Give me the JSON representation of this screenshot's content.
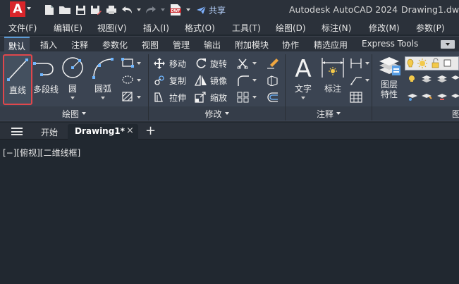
{
  "title_bar": {
    "app_letter": "A",
    "share_label": "共享",
    "dwf_label": "DWF",
    "app_title": "Autodesk AutoCAD 2024",
    "file_title": "Drawing1.dwg"
  },
  "menu": {
    "items": [
      "文件(F)",
      "编辑(E)",
      "视图(V)",
      "插入(I)",
      "格式(O)",
      "工具(T)",
      "绘图(D)",
      "标注(N)",
      "修改(M)",
      "参数(P)"
    ]
  },
  "ribbon_tabs": {
    "items": [
      "默认",
      "插入",
      "注释",
      "参数化",
      "视图",
      "管理",
      "输出",
      "附加模块",
      "协作",
      "精选应用",
      "Express Tools"
    ]
  },
  "draw_panel": {
    "title": "绘图",
    "line": "直线",
    "polyline": "多段线",
    "circle": "圆",
    "arc": "圆弧"
  },
  "modify_panel": {
    "title": "修改",
    "move": "移动",
    "rotate": "旋转",
    "copy": "复制",
    "mirror": "镜像",
    "stretch": "拉伸",
    "scale": "缩放"
  },
  "annotation_panel": {
    "title": "注释",
    "text": "文字",
    "dimension": "标注"
  },
  "layers_panel": {
    "properties_line1": "图层",
    "properties_line2": "特性",
    "title_partial": "图"
  },
  "doc_tabs": {
    "start": "开始",
    "active": "Drawing1*",
    "close_glyph": "×",
    "add_glyph": "+"
  },
  "viewport": {
    "label": "[−][俯视][二维线框]"
  },
  "colors": {
    "accent": "#e0474c",
    "background": "#212830",
    "ribbon": "#3b4452"
  }
}
